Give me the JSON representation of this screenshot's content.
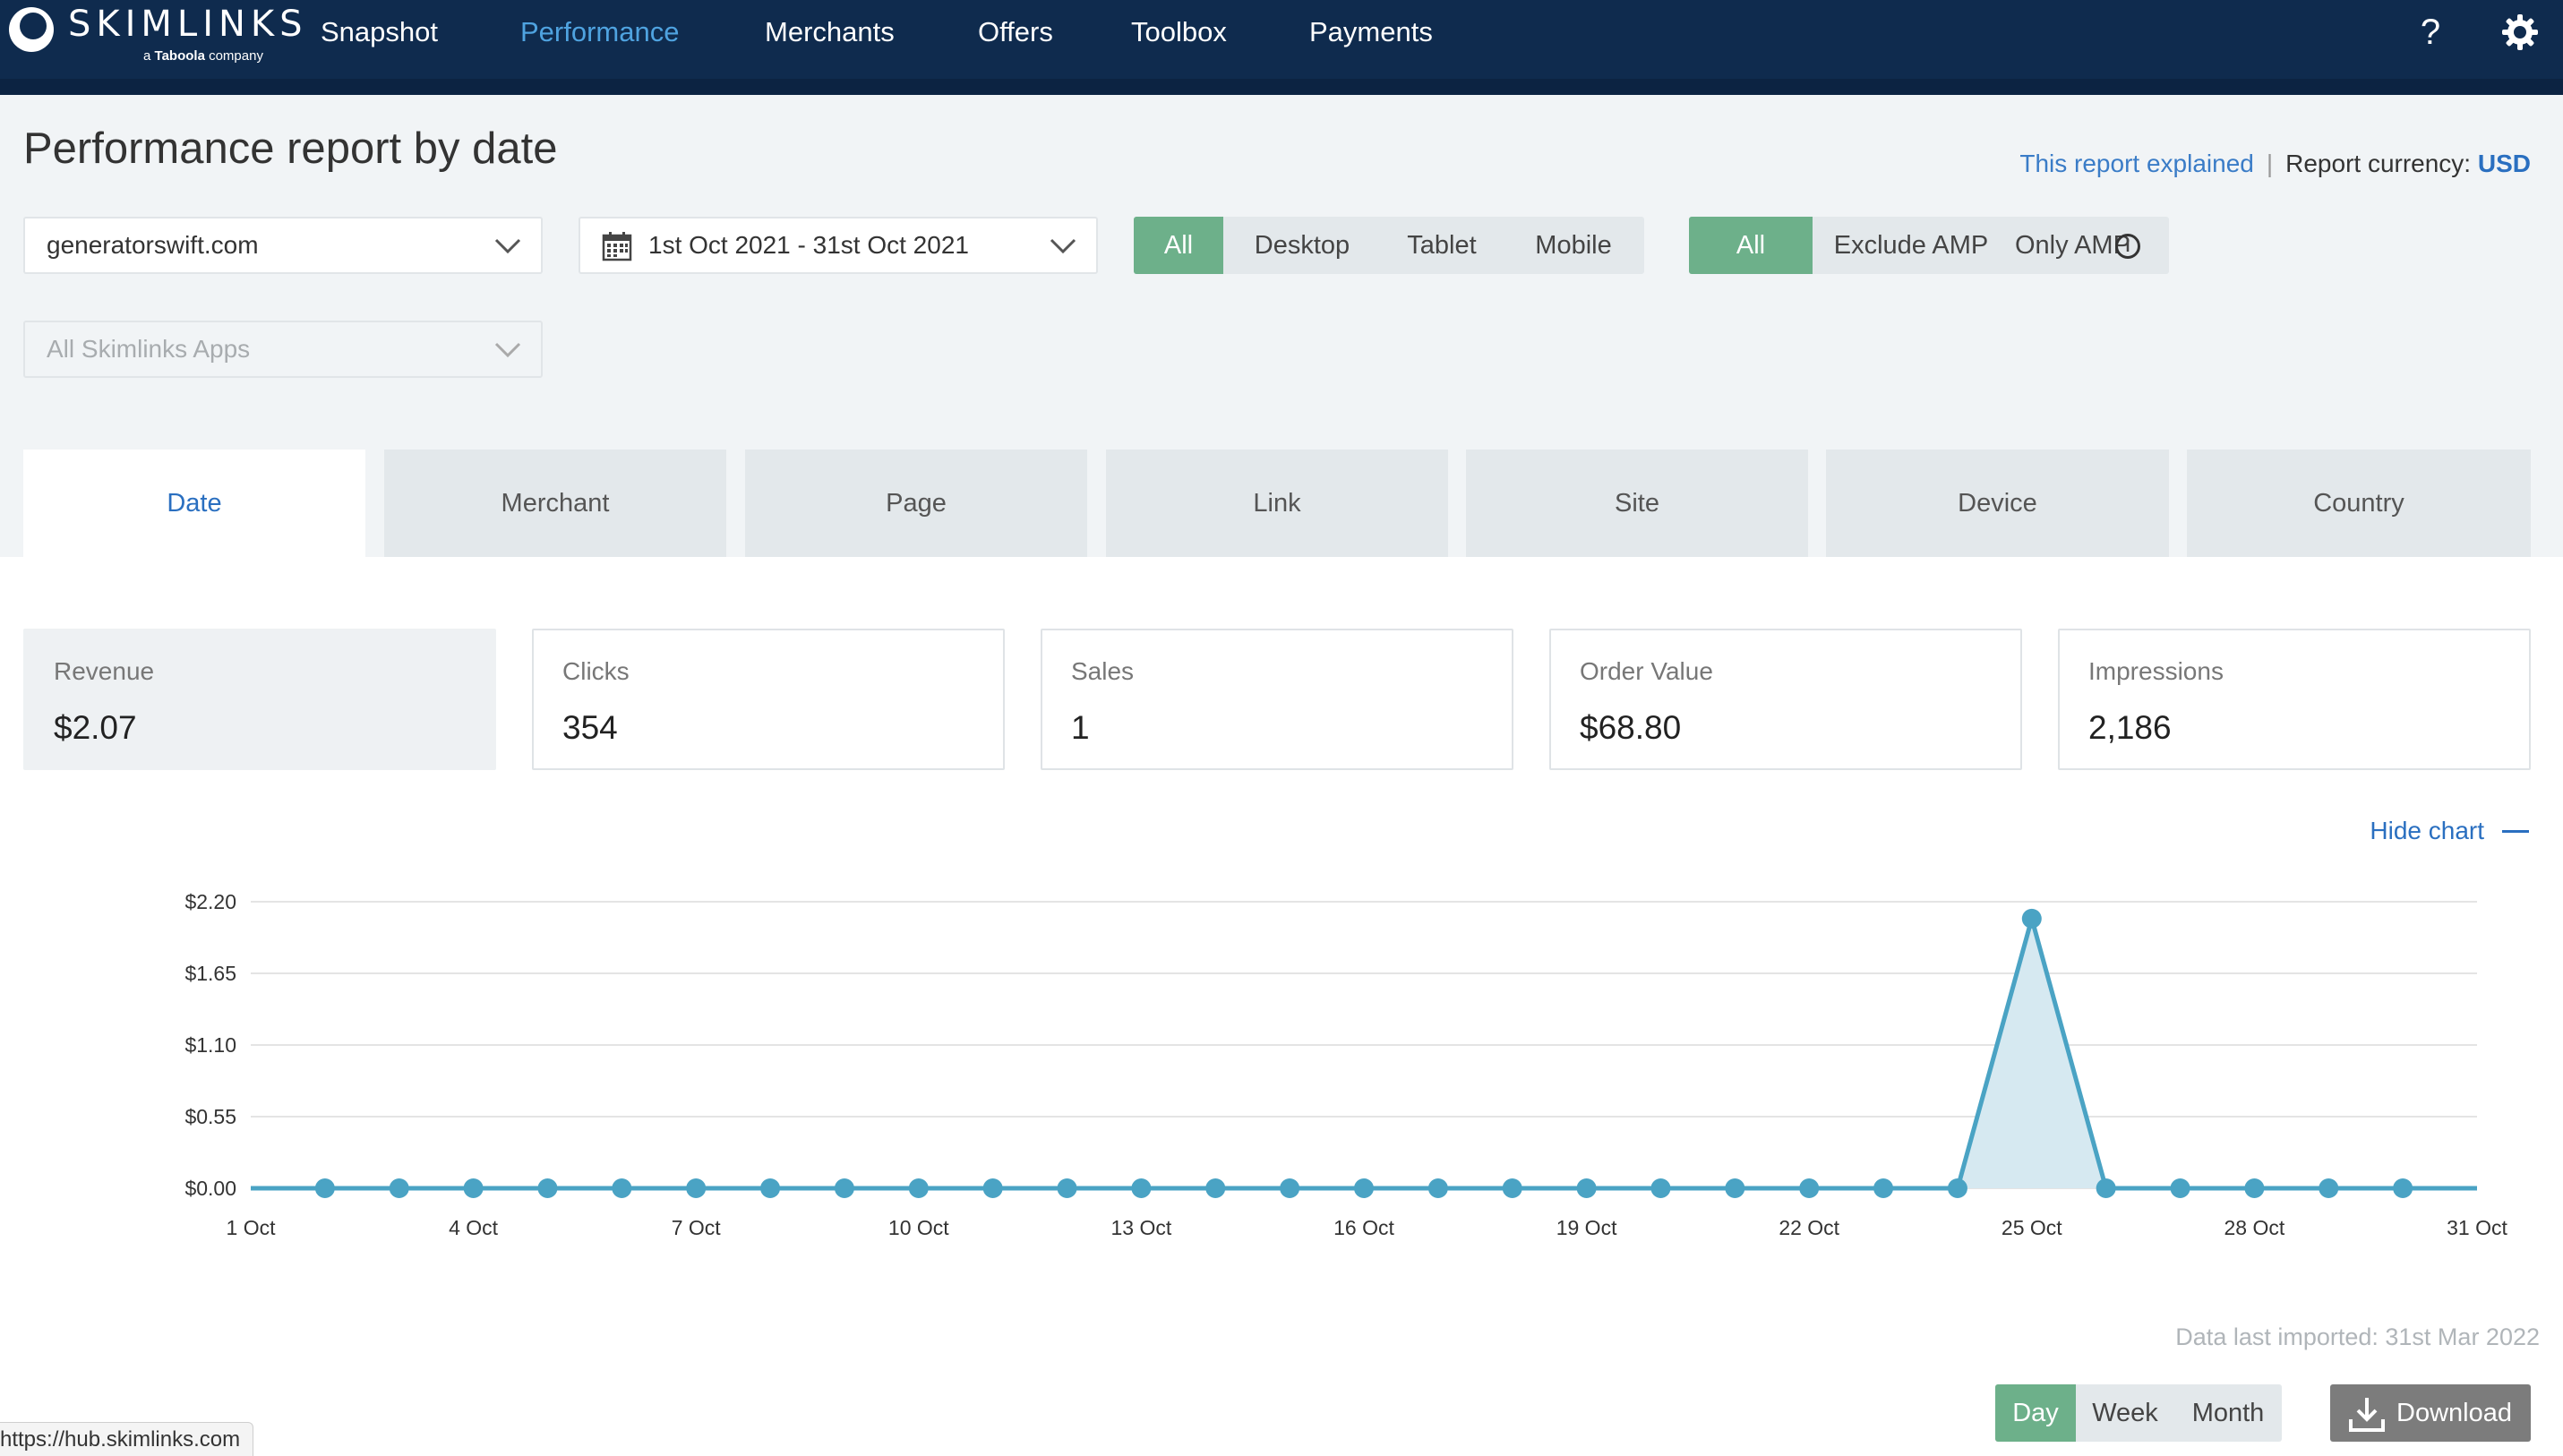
{
  "nav": {
    "logo_word": "SKIMLINKS",
    "logo_sub_prefix": "a",
    "logo_sub_brand": "Taboola",
    "logo_sub_suffix": "company",
    "items": [
      "Snapshot",
      "Performance",
      "Merchants",
      "Offers",
      "Toolbox",
      "Payments"
    ],
    "active": "Performance",
    "help_icon": "?",
    "settings_icon": "gear-icon"
  },
  "header": {
    "title": "Performance report by date",
    "report_explained": "This report explained",
    "currency_label": "Report currency:",
    "currency_value": "USD"
  },
  "filters": {
    "site": "generatorswift.com",
    "date_range": "1st Oct 2021 - 31st Oct 2021",
    "apps": "All Skimlinks Apps",
    "device_options": [
      "All",
      "Desktop",
      "Tablet",
      "Mobile"
    ],
    "device_selected": "All",
    "amp_options": [
      "All",
      "Exclude AMP",
      "Only AMP"
    ],
    "amp_selected": "All"
  },
  "tabs": {
    "items": [
      "Date",
      "Merchant",
      "Page",
      "Link",
      "Site",
      "Device",
      "Country"
    ],
    "active": "Date"
  },
  "metrics": [
    {
      "label": "Revenue",
      "value": "$2.07"
    },
    {
      "label": "Clicks",
      "value": "354"
    },
    {
      "label": "Sales",
      "value": "1"
    },
    {
      "label": "Order Value",
      "value": "$68.80"
    },
    {
      "label": "Impressions",
      "value": "2,186"
    }
  ],
  "hide_chart": "Hide chart",
  "chart_data": {
    "type": "area",
    "title": "",
    "xlabel": "",
    "ylabel": "",
    "y_tick_labels": [
      "$0.00",
      "$0.55",
      "$1.10",
      "$1.65",
      "$2.20"
    ],
    "y_ticks": [
      0,
      0.55,
      1.1,
      1.65,
      2.2
    ],
    "ylim": [
      0,
      2.2
    ],
    "x_tick_labels": [
      "1 Oct",
      "4 Oct",
      "7 Oct",
      "10 Oct",
      "13 Oct",
      "16 Oct",
      "19 Oct",
      "22 Oct",
      "25 Oct",
      "28 Oct",
      "31 Oct"
    ],
    "x_tick_days": [
      1,
      4,
      7,
      10,
      13,
      16,
      19,
      22,
      25,
      28,
      31
    ],
    "x_days": [
      1,
      2,
      3,
      4,
      5,
      6,
      7,
      8,
      9,
      10,
      11,
      12,
      13,
      14,
      15,
      16,
      17,
      18,
      19,
      20,
      21,
      22,
      23,
      24,
      25,
      26,
      27,
      28,
      29,
      30,
      31
    ],
    "series": [
      {
        "values": [
          0,
          0,
          0,
          0,
          0,
          0,
          0,
          0,
          0,
          0,
          0,
          0,
          0,
          0,
          0,
          0,
          0,
          0,
          0,
          0,
          0,
          0,
          0,
          0,
          2.07,
          0,
          0,
          0,
          0,
          0,
          0
        ]
      }
    ],
    "grid": true,
    "colors": {
      "line": "#4aa3c4",
      "fill": "#d6e9f1",
      "grid": "#e4e4e4"
    }
  },
  "data_imported": "Data last imported: 31st Mar 2022",
  "granularity": {
    "options": [
      "Day",
      "Week",
      "Month"
    ],
    "selected": "Day"
  },
  "download_label": "Download",
  "status_url": "https://hub.skimlinks.com"
}
